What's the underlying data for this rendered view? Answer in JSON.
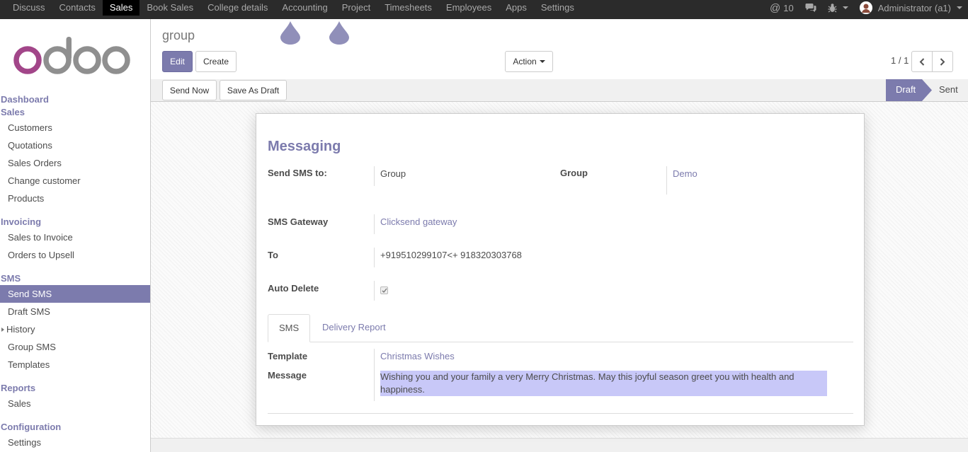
{
  "topmenu": {
    "items": [
      "Discuss",
      "Contacts",
      "Sales",
      "Book Sales",
      "College details",
      "Accounting",
      "Project",
      "Timesheets",
      "Employees",
      "Apps",
      "Settings"
    ],
    "active": "Sales"
  },
  "topright": {
    "mentions_count": "10",
    "user": "Administrator (a1)"
  },
  "sidebar": {
    "sections": [
      {
        "title": "Dashboard"
      },
      {
        "title": "Sales",
        "items": [
          "Customers",
          "Quotations",
          "Sales Orders",
          "Change customer",
          "Products"
        ]
      },
      {
        "title": "Invoicing",
        "items": [
          "Sales to Invoice",
          "Orders to Upsell"
        ]
      },
      {
        "title": "SMS",
        "items": [
          "Send SMS",
          "Draft SMS",
          "History",
          "Group SMS",
          "Templates"
        ]
      },
      {
        "title": "Reports",
        "items": [
          "Sales"
        ]
      },
      {
        "title": "Configuration",
        "items": [
          "Settings"
        ]
      }
    ],
    "active_item": "Send SMS"
  },
  "control_panel": {
    "breadcrumb": "group",
    "edit_label": "Edit",
    "create_label": "Create",
    "action_label": "Action",
    "pager": "1 / 1"
  },
  "statusbar": {
    "send_now_label": "Send Now",
    "save_draft_label": "Save As Draft",
    "stages": [
      "Draft",
      "Sent"
    ],
    "current_stage": "Draft"
  },
  "form": {
    "title": "Messaging",
    "send_sms_to_label": "Send SMS to:",
    "send_sms_to_value": "Group",
    "group_label": "Group",
    "group_value": "Demo",
    "gateway_label": "SMS Gateway",
    "gateway_value": "Clicksend gateway",
    "to_label": "To",
    "to_value": "+919510299107<+ 918320303768",
    "auto_delete_label": "Auto Delete",
    "auto_delete_checked": true,
    "tabs": [
      "SMS",
      "Delivery Report"
    ],
    "active_tab": "SMS",
    "template_label": "Template",
    "template_value": "Christmas Wishes",
    "message_label": "Message",
    "message_value": "Wishing you and your family a very Merry Christmas. May this joyful season greet you with health and happiness."
  },
  "colors": {
    "accent": "#7c7bad",
    "topbar": "#2b2b2b",
    "selection": "#c8c8f8"
  }
}
